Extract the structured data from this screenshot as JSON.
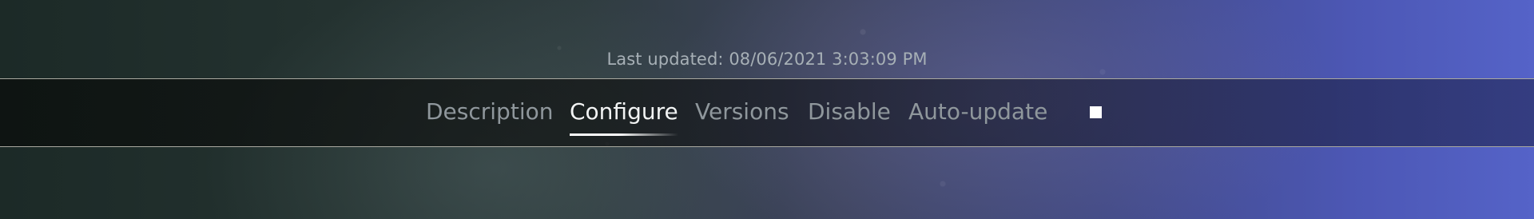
{
  "status": {
    "last_updated": "Last updated: 08/06/2021 3:03:09 PM"
  },
  "tabs": [
    {
      "label": "Description",
      "active": false
    },
    {
      "label": "Configure",
      "active": true
    },
    {
      "label": "Versions",
      "active": false
    },
    {
      "label": "Disable",
      "active": false
    },
    {
      "label": "Auto-update",
      "active": false
    }
  ],
  "icons": {
    "stop": "stop-icon"
  },
  "colors": {
    "active_text": "#f2f4f4",
    "inactive_text": "#8f979c",
    "status_text": "#a7b0b6"
  }
}
